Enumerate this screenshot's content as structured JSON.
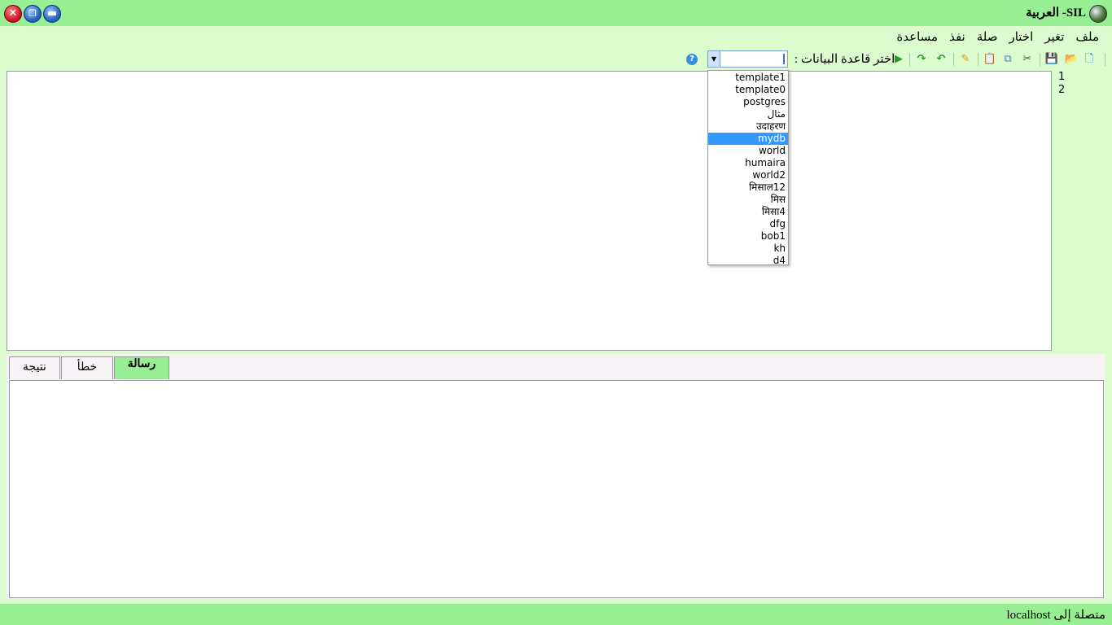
{
  "window": {
    "title": "SIL- العربية"
  },
  "menu": {
    "items": [
      "ملف",
      "تغير",
      "اختار",
      "صلة",
      "نفذ",
      "مساعدة"
    ]
  },
  "toolbar": {
    "icons": [
      "new-file-icon",
      "open-folder-icon",
      "save-icon",
      "cut-icon",
      "copy-icon",
      "paste-icon",
      "clear-icon",
      "undo-icon",
      "redo-icon",
      "run-icon"
    ],
    "db_label": "اختر قاعدة البيانات :",
    "db_value": ""
  },
  "editor": {
    "line_numbers": [
      "1",
      "2"
    ]
  },
  "dropdown": {
    "options": [
      "template1",
      "template0",
      "postgres",
      "مثال",
      "उदाहरण",
      "mydb",
      "world",
      "humaira",
      "world2",
      "मिसाल12",
      "मिस",
      "मिसा4",
      "dfg",
      "bob1",
      "kh",
      "d4"
    ],
    "selected": "mydb"
  },
  "tabs": {
    "result": "نتيجة",
    "error": "خطأ",
    "message": "رسالة"
  },
  "status": {
    "text": "متصلة إلى  localhost"
  },
  "colors": {
    "titlebar": "#98ee92",
    "background": "#dcfcd0",
    "selection": "#3399ff"
  }
}
